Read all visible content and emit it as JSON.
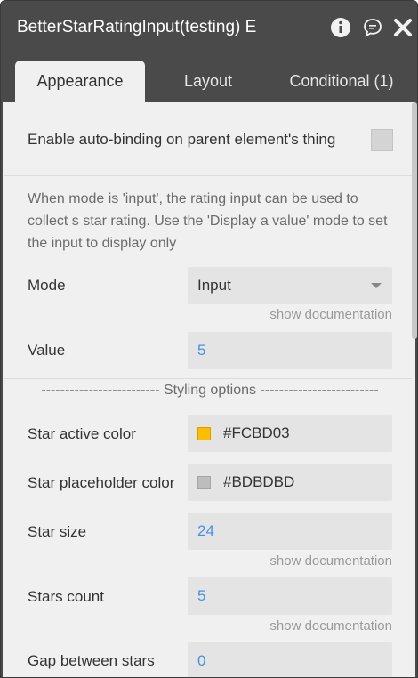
{
  "window": {
    "title": "BetterStarRatingInput(testing) E"
  },
  "tabs": [
    {
      "label": "Appearance",
      "active": true
    },
    {
      "label": "Layout",
      "active": false
    },
    {
      "label": "Conditional (1)",
      "active": false
    }
  ],
  "autobind": {
    "label": "Enable auto-binding on parent element's thing",
    "checked": false
  },
  "description": "When mode is 'input', the rating input can be used to collect s star rating. Use the 'Display a value' mode to set the input to display only",
  "fields": {
    "mode": {
      "label": "Mode",
      "value": "Input"
    },
    "value": {
      "label": "Value",
      "value": "5"
    },
    "star_active_color": {
      "label": "Star active color",
      "value": "#FCBD03",
      "swatch": "#FCBD03"
    },
    "star_placeholder_color": {
      "label": "Star placeholder color",
      "value": "#BDBDBD",
      "swatch": "#BDBDBD"
    },
    "star_size": {
      "label": "Star size",
      "value": "24"
    },
    "stars_count": {
      "label": "Stars count",
      "value": "5"
    },
    "gap_between_stars": {
      "label": "Gap between stars",
      "value": "0"
    }
  },
  "show_documentation": "show documentation",
  "styling_section": "------------------------- Styling options -------------------------",
  "icons": {
    "info": "info-icon",
    "comment": "comment-icon",
    "close": "close-icon",
    "dropdown": "chevron-down-icon"
  },
  "colors": {
    "header_bg": "#4a4a4a",
    "content_bg": "#f0f0f0",
    "field_bg": "#e4e4e4",
    "value_blue": "#4a90e2"
  }
}
